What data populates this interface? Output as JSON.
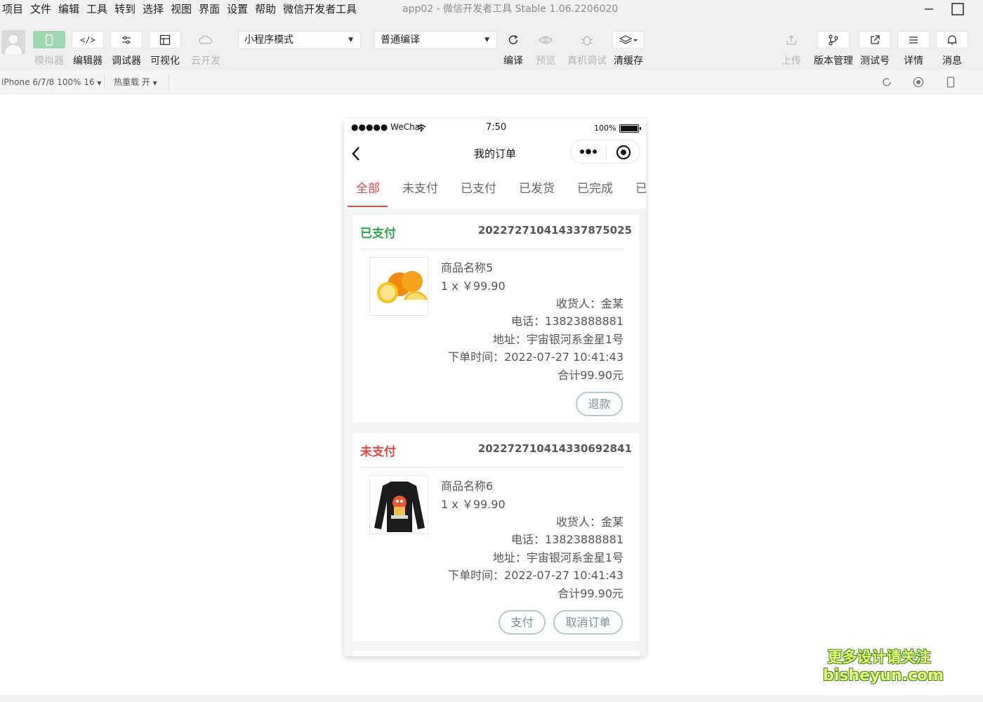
{
  "menu": {
    "items": [
      "项目",
      "文件",
      "编辑",
      "工具",
      "转到",
      "选择",
      "视图",
      "界面",
      "设置",
      "帮助",
      "微信开发者工具"
    ],
    "app_title": "app02 - 微信开发者工具 Stable 1.06.2206020"
  },
  "toolbar": {
    "simulator_label": "模拟器",
    "editor_label": "编辑器",
    "debugger_label": "调试器",
    "visual_label": "可视化",
    "cloud_label": "云开发",
    "mode_select": "小程序模式",
    "compile_select": "普通编译",
    "compile_label": "编译",
    "preview_label": "预览",
    "device_debug_label": "真机调试",
    "clear_cache_label": "清缓存",
    "upload_label": "上传",
    "version_label": "版本管理",
    "test_label": "测试号",
    "details_label": "详情",
    "messages_label": "消息"
  },
  "subbar": {
    "device": "iPhone 6/7/8 100% 16",
    "hot_reload": "热重载 开"
  },
  "phone": {
    "status": {
      "carrier": "●●●●● WeChat",
      "time": "7:50",
      "battery": "100%"
    },
    "nav_title": "我的订单",
    "tabs": [
      "全部",
      "未支付",
      "已支付",
      "已发货",
      "已完成",
      "已"
    ],
    "orders": [
      {
        "status": "已支付",
        "status_color": "#2ba84a",
        "order_no": "202272710414337875025",
        "product_name": "商品名称5",
        "qty_price": "1 x ￥99.90",
        "receiver": "收货人：金某",
        "phone": "电话：13823888881",
        "address": "地址：宇宙银河系金星1号",
        "order_time": "下单时间：2022-07-27 10:41:43",
        "total": "合计99.90元",
        "buttons": [
          "退款"
        ],
        "image": "orange-image"
      },
      {
        "status": "未支付",
        "status_color": "#e64340",
        "order_no": "202272710414330692841",
        "product_name": "商品名称6",
        "qty_price": "1 x ￥99.90",
        "receiver": "收货人：金某",
        "phone": "电话：13823888881",
        "address": "地址：宇宙银河系金星1号",
        "order_time": "下单时间：2022-07-27 10:41:43",
        "total": "合计99.90元",
        "buttons": [
          "支付",
          "取消订单"
        ],
        "image": "shirt-image"
      }
    ]
  },
  "watermark": {
    "line1": "更多设计请关注",
    "line2": "bisheyun.com"
  },
  "colors": {
    "accent_red": "#e64340",
    "paid_green": "#2ba84a",
    "simulator_green": "#9dd8b0"
  }
}
